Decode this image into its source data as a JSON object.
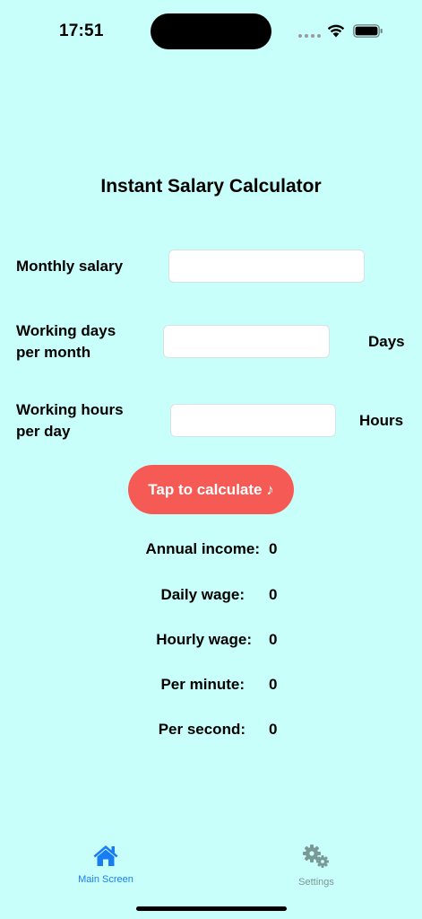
{
  "status_bar": {
    "time": "17:51"
  },
  "title": "Instant Salary Calculator",
  "form": {
    "monthly_salary": {
      "label": "Monthly salary",
      "value": ""
    },
    "working_days": {
      "label_line1": "Working days",
      "label_line2": "per month",
      "value": "",
      "unit": "Days"
    },
    "working_hours": {
      "label_line1": "Working hours",
      "label_line2": "per day",
      "value": "",
      "unit": "Hours"
    }
  },
  "button": {
    "label": "Tap to calculate ♪"
  },
  "results": [
    {
      "label": "Annual income:",
      "value": "0"
    },
    {
      "label": "Daily wage:",
      "value": "0"
    },
    {
      "label": "Hourly wage:",
      "value": "0"
    },
    {
      "label": "Per minute:",
      "value": "0"
    },
    {
      "label": "Per second:",
      "value": "0"
    }
  ],
  "tab_bar": {
    "main": {
      "label": "Main Screen",
      "icon": "house-icon",
      "color": "#1a7cf2"
    },
    "settings": {
      "label": "Settings",
      "icon": "gears-icon",
      "color": "#7a9895"
    }
  },
  "colors": {
    "background": "#c8fffa",
    "button": "#f65a55",
    "accent": "#1a7cf2"
  }
}
